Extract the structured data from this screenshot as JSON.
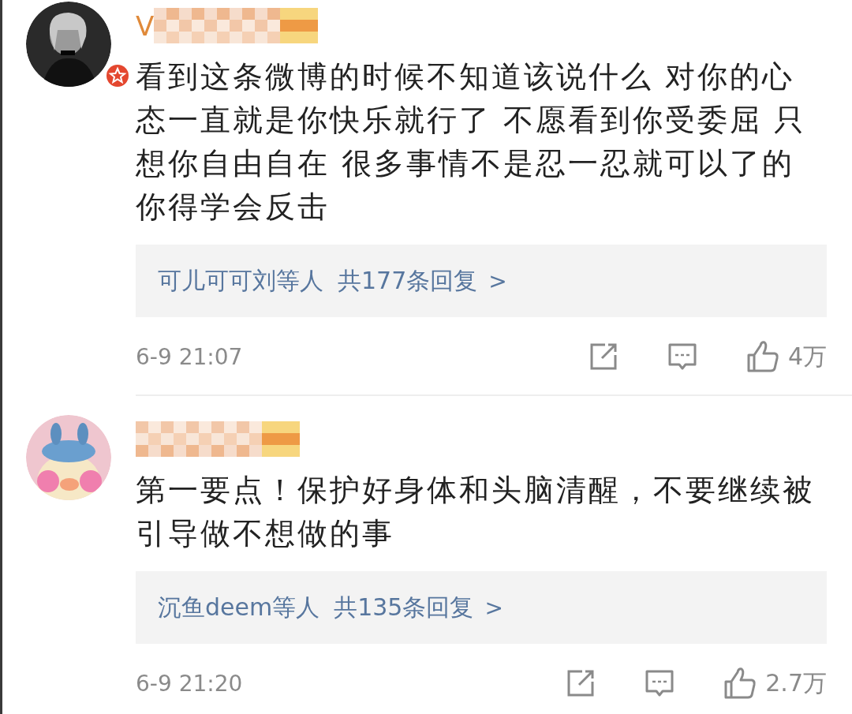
{
  "comments": [
    {
      "username_visible": "V",
      "verified": true,
      "text": "看到这条微博的时候不知道该说什么 对你的心态一直就是你快乐就行了 不愿看到你受委屈 只想你自由自在 很多事情不是忍一忍就可以了的你得学会反击",
      "replies": {
        "users": "可儿可可刘等人",
        "count": "共177条回复",
        "chevron": ">"
      },
      "time": "6-9 21:07",
      "likes": "4万"
    },
    {
      "verified": false,
      "text": "第一要点！保护好身体和头脑清醒，不要继续被引导做不想做的事",
      "replies": {
        "users": "沉鱼deem等人",
        "count": "共135条回复",
        "chevron": ">"
      },
      "time": "6-9 21:20",
      "likes": "2.7万"
    }
  ]
}
